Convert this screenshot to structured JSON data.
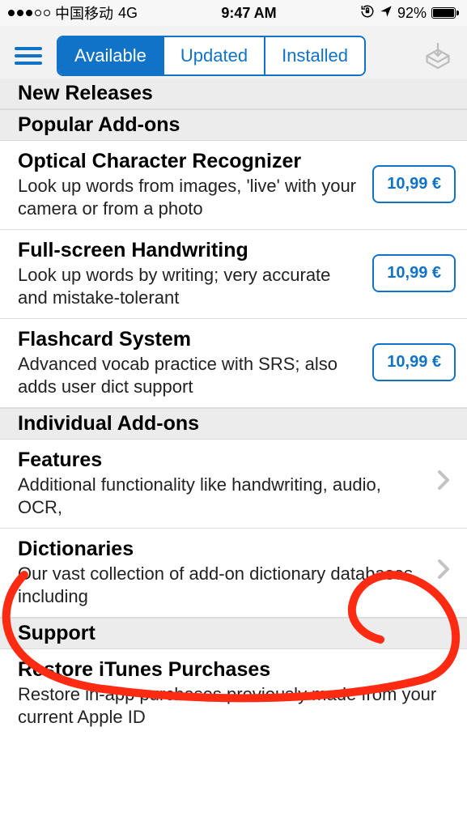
{
  "statusbar": {
    "carrier": "中国移动",
    "network": "4G",
    "time": "9:47 AM",
    "battery_pct": "92%"
  },
  "toolbar": {
    "tab_available": "Available",
    "tab_updated": "Updated",
    "tab_installed": "Installed"
  },
  "sections": {
    "new_releases": "New Releases",
    "popular": "Popular Add-ons",
    "individual": "Individual Add-ons",
    "support": "Support"
  },
  "addons": {
    "ocr": {
      "title": "Optical Character Recognizer",
      "desc": "Look up words from images, 'live' with your camera or from a photo",
      "price": "10,99 €"
    },
    "handwriting": {
      "title": "Full-screen Handwriting",
      "desc": "Look up words by writing; very accurate and mistake-tolerant",
      "price": "10,99 €"
    },
    "flashcards": {
      "title": "Flashcard System",
      "desc": "Advanced vocab practice with SRS; also adds user dict support",
      "price": "10,99 €"
    },
    "features": {
      "title": "Features",
      "desc": "Additional functionality like handwriting, audio, OCR,"
    },
    "dictionaries": {
      "title": "Dictionaries",
      "desc": "Our vast collection of add-on dictionary databases, including"
    },
    "restore": {
      "title": "Restore iTunes Purchases",
      "desc": "Restore in-app purchases previously made from your current Apple ID"
    }
  }
}
